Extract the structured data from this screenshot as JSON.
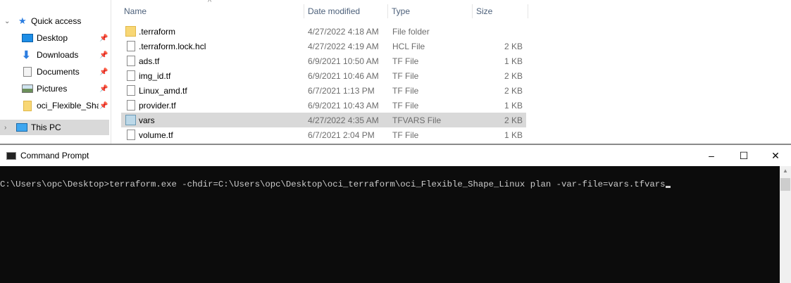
{
  "nav": {
    "items": [
      {
        "label": "Quick access",
        "icon": "star-icon"
      },
      {
        "label": "Desktop",
        "icon": "desktop-icon",
        "pinned": true
      },
      {
        "label": "Downloads",
        "icon": "download-icon",
        "pinned": true
      },
      {
        "label": "Documents",
        "icon": "documents-icon",
        "pinned": true
      },
      {
        "label": "Pictures",
        "icon": "pictures-icon",
        "pinned": true
      },
      {
        "label": "oci_Flexible_Shape_Linux",
        "icon": "folder-icon",
        "pinned": true
      },
      {
        "label": "This PC",
        "icon": "computer-icon"
      }
    ]
  },
  "columns": {
    "name": "Name",
    "date": "Date modified",
    "type": "Type",
    "size": "Size"
  },
  "files": [
    {
      "name": ".terraform",
      "date": "4/27/2022 4:18 AM",
      "type": "File folder",
      "size": ""
    },
    {
      "name": ".terraform.lock.hcl",
      "date": "4/27/2022 4:19 AM",
      "type": "HCL File",
      "size": "2 KB"
    },
    {
      "name": "ads.tf",
      "date": "6/9/2021 10:50 AM",
      "type": "TF File",
      "size": "1 KB"
    },
    {
      "name": "img_id.tf",
      "date": "6/9/2021 10:46 AM",
      "type": "TF File",
      "size": "2 KB"
    },
    {
      "name": "Linux_amd.tf",
      "date": "6/7/2021 1:13 PM",
      "type": "TF File",
      "size": "2 KB"
    },
    {
      "name": "provider.tf",
      "date": "6/9/2021 10:43 AM",
      "type": "TF File",
      "size": "1 KB"
    },
    {
      "name": "vars",
      "date": "4/27/2022 4:35 AM",
      "type": "TFVARS File",
      "size": "2 KB"
    },
    {
      "name": "volume.tf",
      "date": "6/7/2021 2:04 PM",
      "type": "TF File",
      "size": "1 KB"
    }
  ],
  "cmd": {
    "title": "Command Prompt",
    "line": "C:\\Users\\opc\\Desktop>terraform.exe -chdir=C:\\Users\\opc\\Desktop\\oci_terraform\\oci_Flexible_Shape_Linux plan -var-file=vars.tfvars",
    "minimize": "–",
    "maximize": "☐",
    "close": "✕"
  }
}
